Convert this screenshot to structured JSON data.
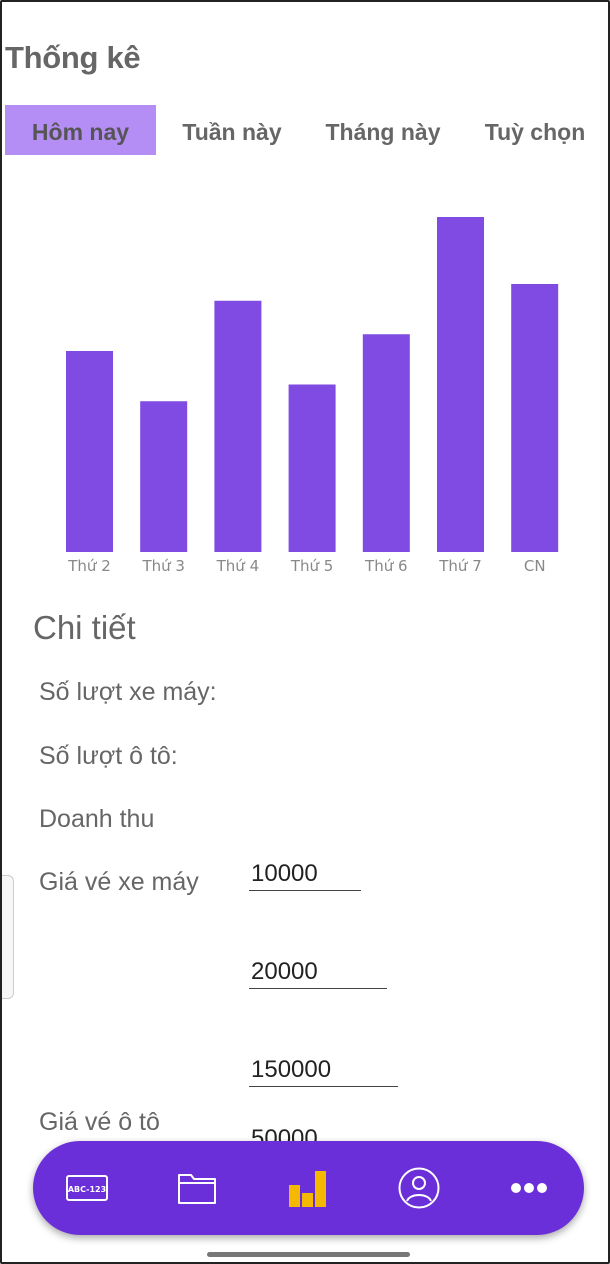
{
  "header": {
    "title": "Thống kê"
  },
  "tabs": [
    {
      "label": "Hôm nay",
      "active": true
    },
    {
      "label": "Tuần này",
      "active": false
    },
    {
      "label": "Tháng này",
      "active": false
    },
    {
      "label": "Tuỳ chọn",
      "active": false
    }
  ],
  "chart_data": {
    "type": "bar",
    "categories": [
      "Thứ 2",
      "Thứ 3",
      "Thứ 4",
      "Thứ 5",
      "Thứ 6",
      "Thứ 7",
      "CN"
    ],
    "values": [
      60,
      45,
      75,
      50,
      65,
      100,
      80
    ],
    "ylim": [
      0,
      100
    ],
    "grid": false,
    "color": "#7f4be2"
  },
  "details": {
    "title": "Chi tiết",
    "motorbike_count_label": "Số lượt xe máy:",
    "car_count_label": "Số lượt ô tô:",
    "revenue_label": "Doanh thu",
    "motorbike_price_label": "Giá vé xe máy",
    "car_price_label": "Giá vé ô tô",
    "inputs": [
      "10000",
      "20000",
      "150000",
      "50000"
    ]
  },
  "navbar": {
    "background": "#6b2fd9",
    "active_color": "#f5b800",
    "items": [
      {
        "icon": "license-plate-icon",
        "text": "ABC-123"
      },
      {
        "icon": "folder-icon"
      },
      {
        "icon": "bar-chart-icon"
      },
      {
        "icon": "user-icon"
      },
      {
        "icon": "more-icon"
      }
    ]
  }
}
